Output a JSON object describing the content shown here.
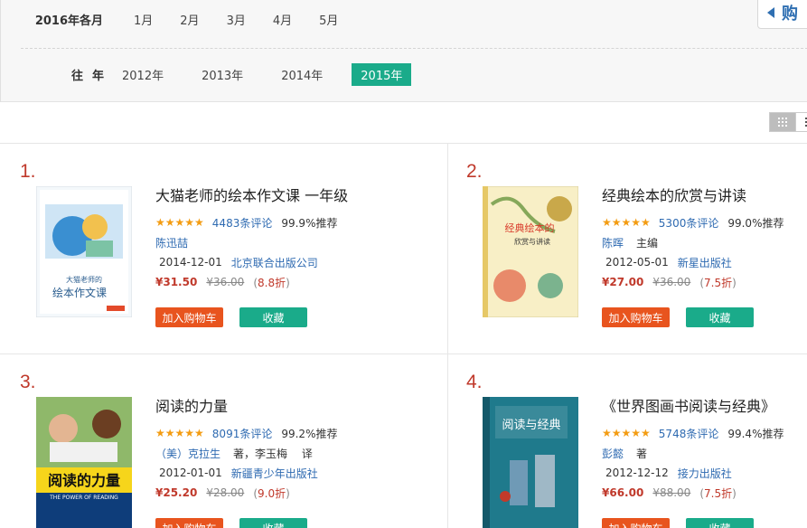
{
  "filter": {
    "month_label": "2016年各月",
    "months": [
      "1月",
      "2月",
      "3月",
      "4月",
      "5月"
    ],
    "year_label": "往年",
    "years": [
      "2012年",
      "2013年",
      "2014年",
      "2015年"
    ],
    "active_year": "2015年"
  },
  "float_tab": {
    "text": "购"
  },
  "books": [
    {
      "rank": "1.",
      "title": "大猫老师的绘本作文课 一年级",
      "stars": "★★★★★",
      "reviews": "4483条评论",
      "recommend": "99.9%推荐",
      "author": "陈迅喆",
      "role": "",
      "date": "2014-12-01",
      "publisher": "北京联合出版公司",
      "price": "¥31.50",
      "orig_price": "¥36.00",
      "disc_open": "(",
      "discount": "8.8折",
      "disc_close": ")",
      "cover_text": "大猫老师的\n绘本作文课",
      "cart_btn": "加入购物车",
      "fav_btn": "收藏"
    },
    {
      "rank": "2.",
      "title": "经典绘本的欣赏与讲读",
      "stars": "★★★★★",
      "reviews": "5300条评论",
      "recommend": "99.0%推荐",
      "author": "陈晖",
      "role": "主编",
      "date": "2012-05-01",
      "publisher": "新星出版社",
      "price": "¥27.00",
      "orig_price": "¥36.00",
      "disc_open": "(",
      "discount": "7.5折",
      "disc_close": ")",
      "cover_text": "经典绘本的\n欣赏与讲读",
      "cart_btn": "加入购物车",
      "fav_btn": "收藏"
    },
    {
      "rank": "3.",
      "title": "阅读的力量",
      "stars": "★★★★★",
      "reviews": "8091条评论",
      "recommend": "99.2%推荐",
      "author": "（美）克拉生",
      "role": "著，李玉梅　 译",
      "date": "2012-01-01",
      "publisher": "新疆青少年出版社",
      "price": "¥25.20",
      "orig_price": "¥28.00",
      "disc_open": "(",
      "discount": "9.0折",
      "disc_close": ")",
      "cover_text": "阅读的力量",
      "cover_sub": "THE POWER OF READING",
      "cart_btn": "加入购物车",
      "fav_btn": "收藏"
    },
    {
      "rank": "4.",
      "title": "《世界图画书阅读与经典》",
      "stars": "★★★★★",
      "reviews": "5748条评论",
      "recommend": "99.4%推荐",
      "author": "彭懿",
      "role": "著",
      "date": "2012-12-12",
      "publisher": "接力出版社",
      "price": "¥66.00",
      "orig_price": "¥88.00",
      "disc_open": "(",
      "discount": "7.5折",
      "disc_close": ")",
      "cover_text": "阅读与经典",
      "cart_btn": "加入购物车",
      "fav_btn": "收藏"
    }
  ],
  "colors": {
    "accent": "#1aab8a",
    "cart": "#e8541e",
    "price": "#c0392b",
    "link": "#2e6ab1"
  }
}
